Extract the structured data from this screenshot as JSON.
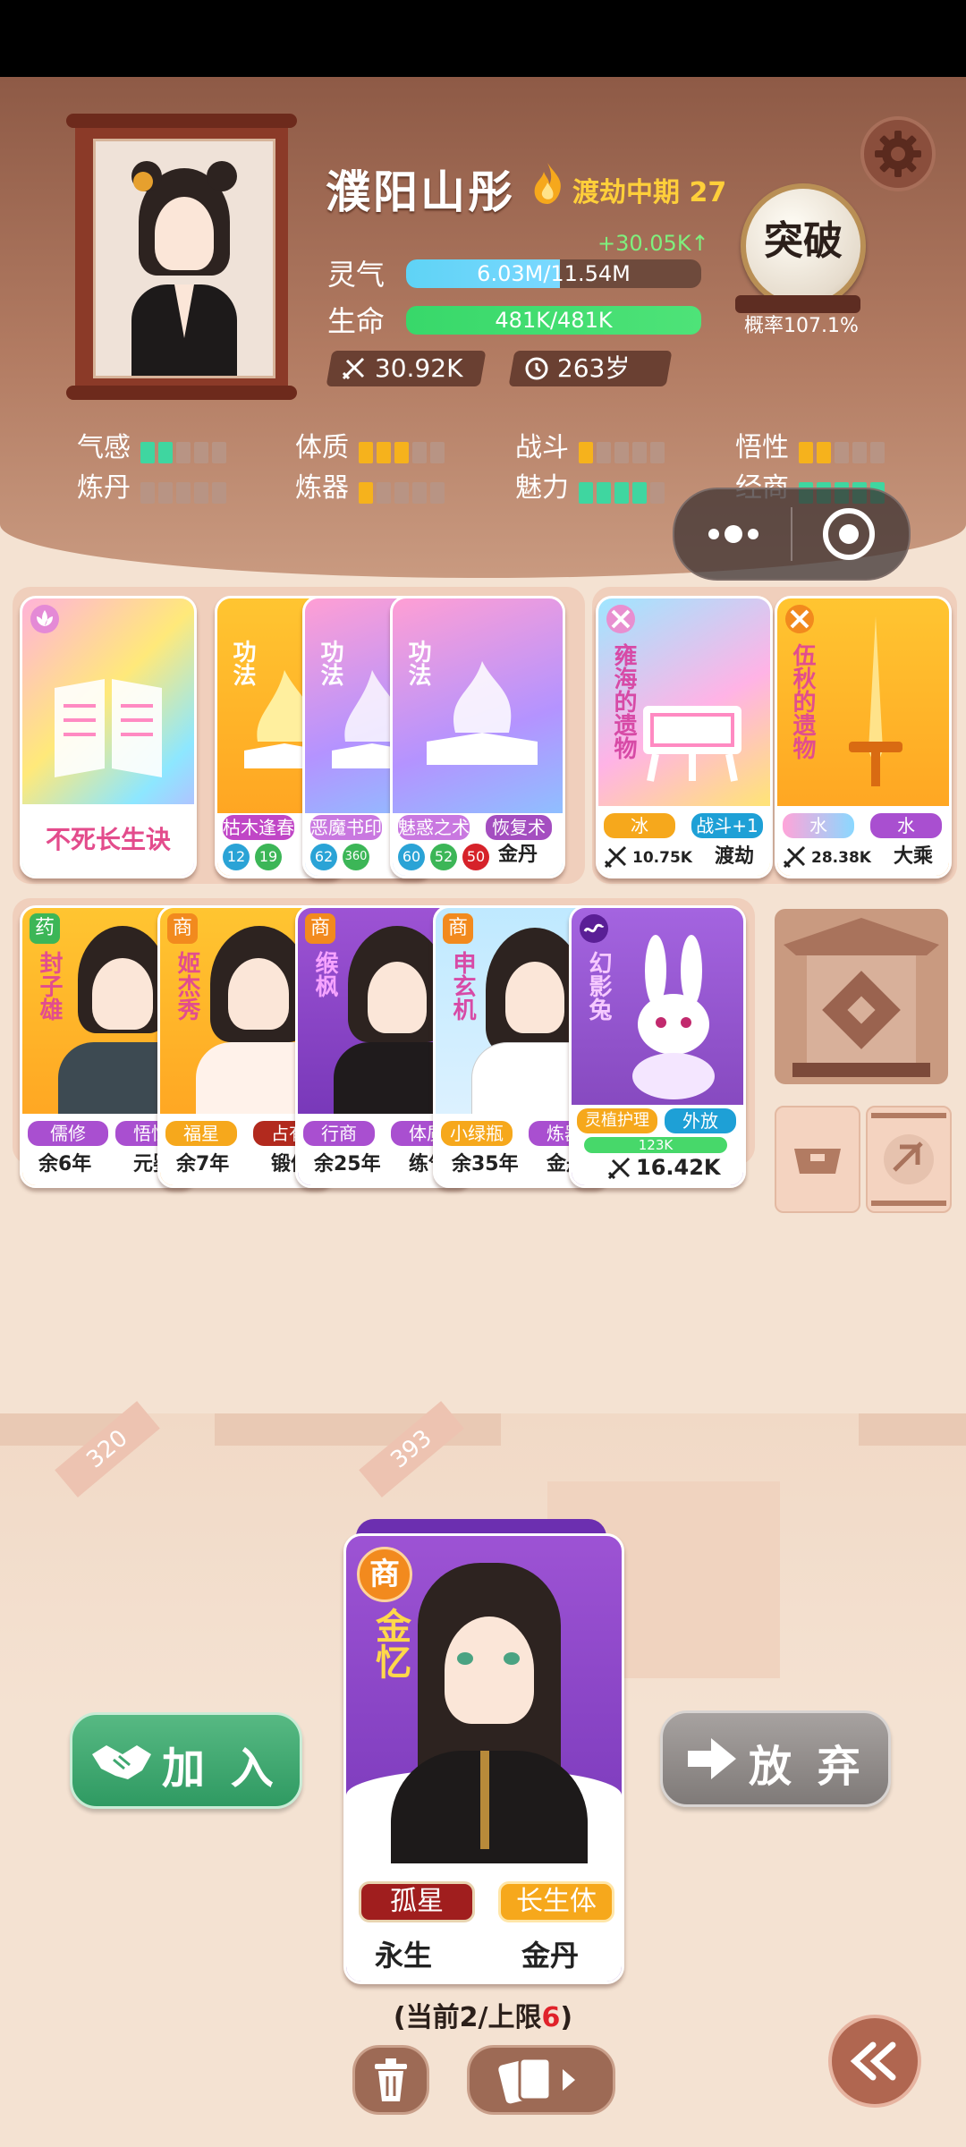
{
  "profile": {
    "name": "濮阳山彤",
    "realm": "渡劫中期 27",
    "qi_gain": "+30.05K↑",
    "qi_label": "灵气",
    "qi_value": "6.03M/11.54M",
    "qi_fill": 0.52,
    "hp_label": "生命",
    "hp_value": "481K/481K",
    "hp_fill": 1.0,
    "power": "30.92K",
    "age": "263岁"
  },
  "breakthrough": {
    "label": "突破",
    "rate": "概率107.1%"
  },
  "attributes": [
    {
      "label": "气感",
      "level": 2,
      "of": 5,
      "color": "#3fd6a0"
    },
    {
      "label": "体质",
      "level": 3,
      "of": 5,
      "color": "#f6b21c"
    },
    {
      "label": "战斗",
      "level": 1,
      "of": 5,
      "color": "#f6b21c"
    },
    {
      "label": "悟性",
      "level": 2,
      "of": 5,
      "color": "#f6b21c"
    },
    {
      "label": "炼丹",
      "level": 0,
      "of": 5,
      "color": "#3fd6a0"
    },
    {
      "label": "炼器",
      "level": 1,
      "of": 5,
      "color": "#f6b21c"
    },
    {
      "label": "魅力",
      "level": 4,
      "of": 5,
      "color": "#3fd6a0"
    },
    {
      "label": "经商",
      "level": 5,
      "of": 5,
      "color": "#3fd6a0"
    }
  ],
  "technique_cards": [
    {
      "title": "不死长生诀"
    },
    {
      "type": "功法",
      "tag1": "枯木逢春",
      "nums": [
        "12",
        "19"
      ]
    },
    {
      "type": "功法",
      "tag1": "恶魔书印",
      "nums": [
        "62",
        "360"
      ]
    },
    {
      "type": "功法",
      "tag1": "魅惑之术",
      "tag2": "恢复术",
      "nums": [
        "60",
        "52",
        "50"
      ],
      "extra": "金丹"
    }
  ],
  "relic_cards": [
    {
      "title": "雍海的遗物",
      "tag1": "冰",
      "tag2": "战斗+1",
      "power": "10.75K",
      "realm": "渡劫"
    },
    {
      "title": "伍秋的遗物",
      "tag1": "水",
      "tag2": "水",
      "power": "28.38K",
      "realm": "大乘"
    }
  ],
  "companions": [
    {
      "badge": "药",
      "name": "封子雄",
      "tag1": "儒修",
      "tag2": "悟性",
      "life": "余6年",
      "extra": "元婴"
    },
    {
      "badge": "商",
      "name": "姬杰秀",
      "tag1": "福星",
      "tag2": "占有",
      "life": "余7年",
      "extra": "锻体"
    },
    {
      "badge": "商",
      "name": "缑枫",
      "tag1": "行商",
      "tag2": "体质",
      "life": "余25年",
      "extra": "练气"
    },
    {
      "badge": "商",
      "name": "申玄机",
      "tag1": "小绿瓶",
      "tag2": "炼器",
      "life": "余35年",
      "extra": "金丹"
    }
  ],
  "pet": {
    "name": "幻影兔",
    "tag1": "灵植护理",
    "tag2": "外放",
    "hp": "123K",
    "power": "16.42K"
  },
  "counters": [
    "320",
    "393"
  ],
  "candidate": {
    "badge": "商",
    "name": "金忆",
    "trait1": "孤星",
    "trait2": "长生体",
    "life": "永生",
    "realm": "金丹"
  },
  "actions": {
    "join": "加 入",
    "quit": "放 弃"
  },
  "capacity": {
    "prefix": "(当前2/上限",
    "limit": "6",
    "suffix": ")"
  },
  "colors": {
    "accent_green": "#2f9a62",
    "purple_card": "#7b3fb3",
    "orange_card": "#f4a425"
  }
}
